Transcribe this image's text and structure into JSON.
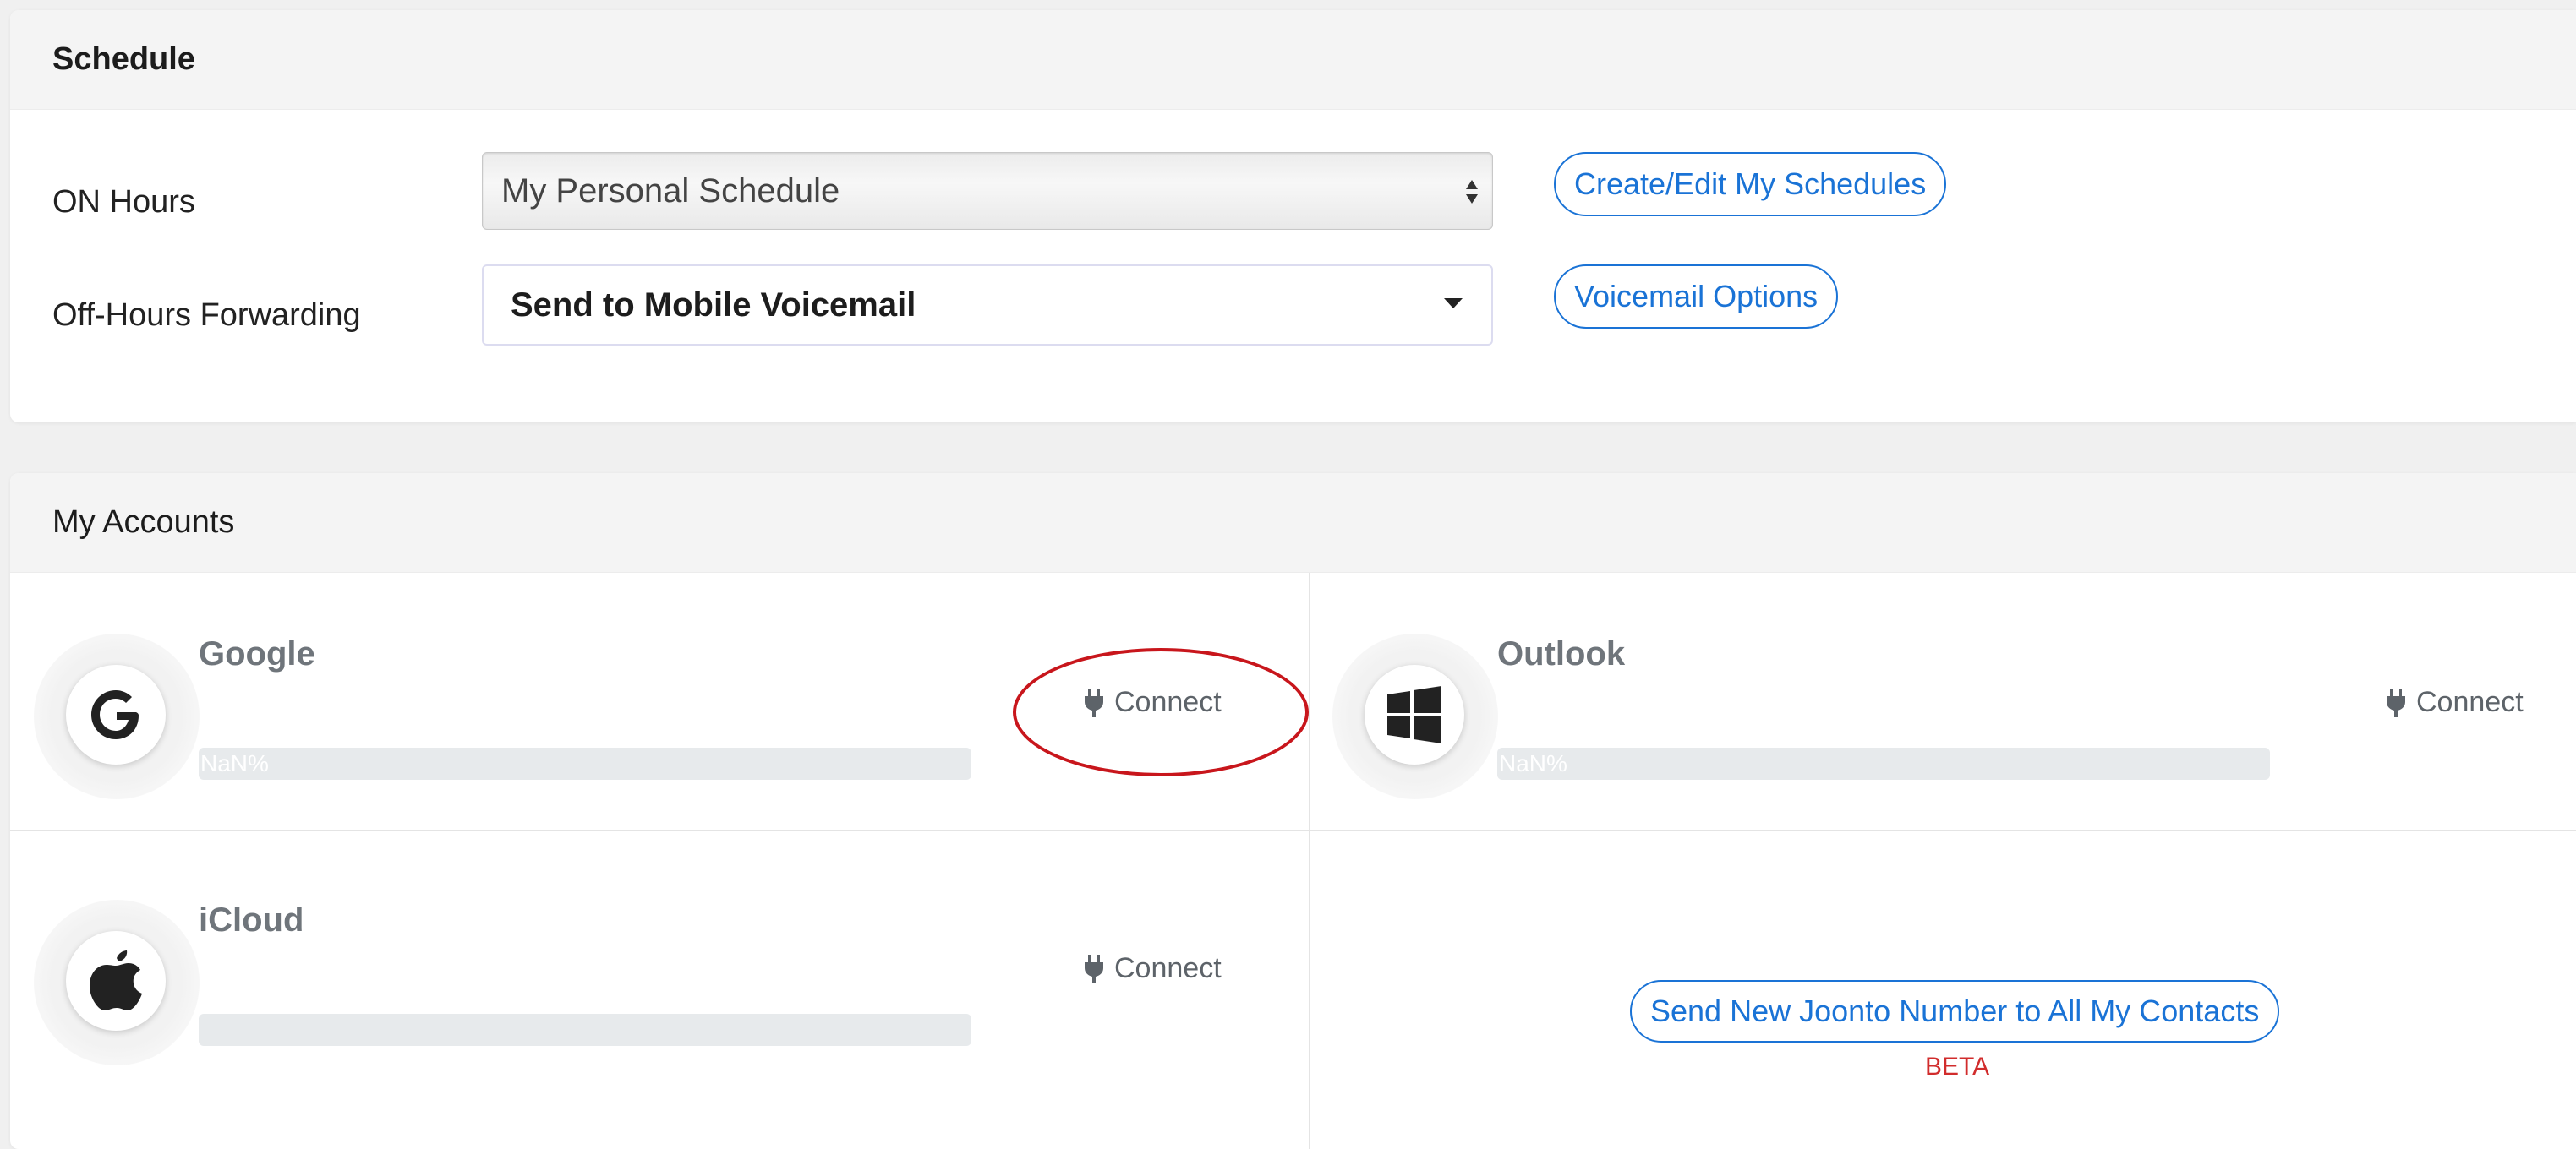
{
  "schedule": {
    "title": "Schedule",
    "on_hours": {
      "label": "ON Hours",
      "selected": "My Personal Schedule",
      "button": "Create/Edit My Schedules"
    },
    "off_hours": {
      "label": "Off-Hours Forwarding",
      "selected": "Send to Mobile Voicemail",
      "button": "Voicemail Options"
    }
  },
  "accounts": {
    "title": "My Accounts",
    "items": [
      {
        "name": "Google",
        "progress_label": "NaN%",
        "connect_label": "Connect",
        "icon": "google-icon"
      },
      {
        "name": "Outlook",
        "progress_label": "NaN%",
        "connect_label": "Connect",
        "icon": "windows-icon"
      },
      {
        "name": "iCloud",
        "progress_label": "",
        "connect_label": "Connect",
        "icon": "apple-icon"
      }
    ],
    "send_contacts_button": "Send New Joonto Number to All My Contacts",
    "beta_label": "BETA"
  },
  "colors": {
    "link_blue": "#1a73d6",
    "beta_red": "#d12c2c",
    "annotation_red": "#c8161c"
  }
}
